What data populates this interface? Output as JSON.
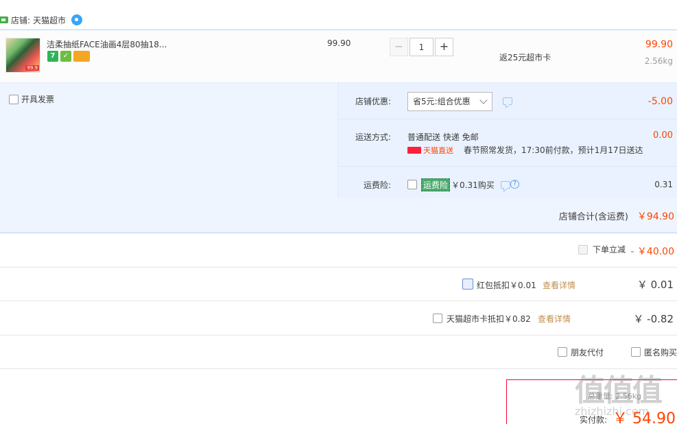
{
  "shop": {
    "label": "店铺:",
    "name": "天猫超市"
  },
  "item": {
    "title": "洁柔抽纸FACE油画4层80抽18...",
    "thumb_price": "99.9",
    "badges": [
      "7",
      "✓",
      ""
    ],
    "unit_price": "99.90",
    "quantity": "1",
    "minus": "−",
    "plus": "+",
    "rebate": "返25元超市卡",
    "subtotal": "99.90",
    "weight": "2.56kg"
  },
  "invoice": {
    "label": "开具发票"
  },
  "services": {
    "discount": {
      "label": "店铺优惠:",
      "selected": "省5元:组合优惠",
      "amount": "-5.00"
    },
    "shipping": {
      "label": "运送方式:",
      "method": "普通配送 快递 免邮",
      "tmall_direct": "天猫直送",
      "note": "春节照常发货，17:30前付款，预计1月17日送达",
      "amount": "0.00"
    },
    "insurance": {
      "label": "运费险:",
      "tag": "运费险",
      "desc": "￥0.31购买",
      "amount": "0.31"
    }
  },
  "totals": {
    "store_total_label": "店铺合计(含运费)",
    "store_total": "￥94.90",
    "instant_label": "下单立减",
    "instant_amount": "- ￥40.00",
    "redpacket_label": "红包抵扣￥0.01",
    "redpacket_link": "查看详情",
    "redpacket_amount": "￥ 0.01",
    "card_label": "天猫超市卡抵扣￥0.82",
    "card_link": "查看详情",
    "card_amount": "￥ -0.82",
    "friend_pay": "朋友代付",
    "anonymous": "匿名购买"
  },
  "pay": {
    "weight_label": "总重量: 2.56kg",
    "paid_label": "实付款:",
    "paid_amount": "￥ 54.90"
  },
  "watermark": {
    "big": "值值值",
    "small": "zhizhizhi.com"
  },
  "colors": {
    "price_red": "#ff4400",
    "blue_border": "#b2d1ff",
    "service_bg": "#eff5ff"
  }
}
